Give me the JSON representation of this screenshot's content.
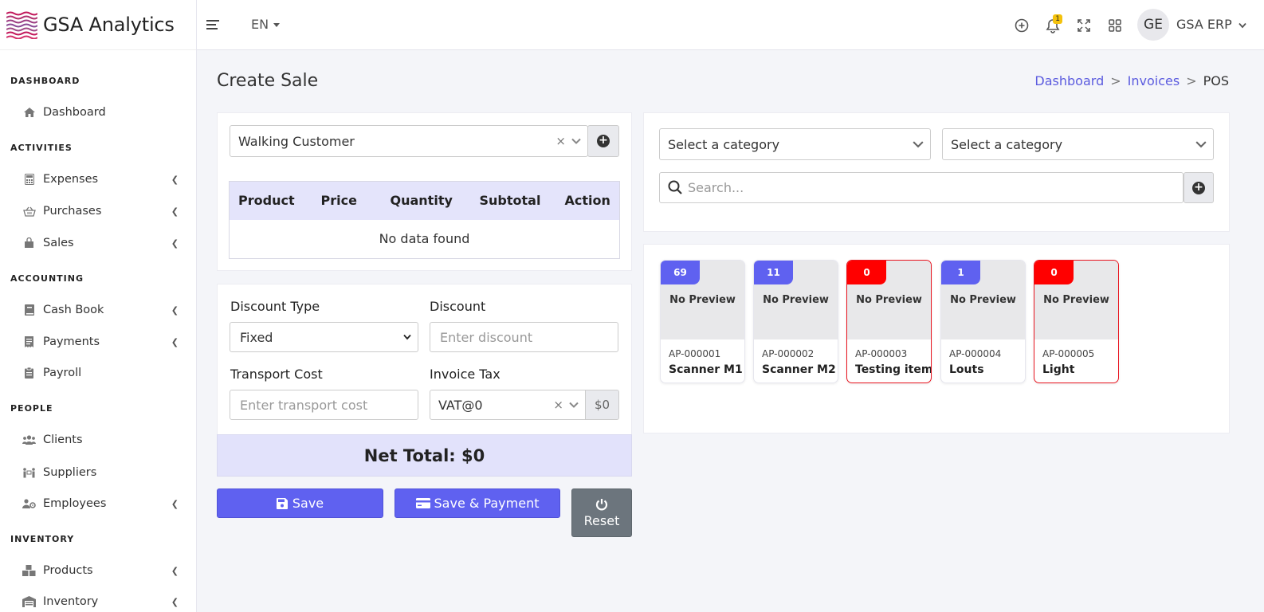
{
  "brand": {
    "name": "GSA Analytics"
  },
  "topbar": {
    "language": "EN",
    "notifications_count": "1",
    "avatar_initials": "GE",
    "user_name": "GSA ERP"
  },
  "sidebar": {
    "sections": [
      {
        "title": "DASHBOARD",
        "items": [
          {
            "label": "Dashboard",
            "icon": "home-icon",
            "has_submenu": false
          }
        ]
      },
      {
        "title": "ACTIVITIES",
        "items": [
          {
            "label": "Expenses",
            "icon": "calculator-icon",
            "has_submenu": true
          },
          {
            "label": "Purchases",
            "icon": "basket-icon",
            "has_submenu": true
          },
          {
            "label": "Sales",
            "icon": "shopping-bag-icon",
            "has_submenu": true
          }
        ]
      },
      {
        "title": "ACCOUNTING",
        "items": [
          {
            "label": "Cash Book",
            "icon": "book-icon",
            "has_submenu": true
          },
          {
            "label": "Payments",
            "icon": "receipt-icon",
            "has_submenu": true
          },
          {
            "label": "Payroll",
            "icon": "clipboard-icon",
            "has_submenu": false
          }
        ]
      },
      {
        "title": "PEOPLE",
        "items": [
          {
            "label": "Clients",
            "icon": "users-icon",
            "has_submenu": false
          },
          {
            "label": "Suppliers",
            "icon": "people-carry-icon",
            "has_submenu": false
          },
          {
            "label": "Employees",
            "icon": "users-cog-icon",
            "has_submenu": true
          }
        ]
      },
      {
        "title": "INVENTORY",
        "items": [
          {
            "label": "Products",
            "icon": "boxes-icon",
            "has_submenu": true
          },
          {
            "label": "Inventory",
            "icon": "warehouse-icon",
            "has_submenu": true
          }
        ]
      }
    ]
  },
  "page": {
    "title": "Create Sale",
    "breadcrumb": {
      "dashboard": "Dashboard",
      "invoices": "Invoices",
      "sep": ">",
      "current": "POS"
    }
  },
  "customer": {
    "selected": "Walking Customer",
    "clear": "×"
  },
  "cart_table": {
    "headers": [
      "Product",
      "Price",
      "Quantity",
      "Subtotal",
      "Action"
    ],
    "empty_message": "No data found"
  },
  "summary": {
    "discount_type_label": "Discount Type",
    "discount_type_value": "Fixed",
    "discount_label": "Discount",
    "discount_placeholder": "Enter discount",
    "transport_label": "Transport Cost",
    "transport_placeholder": "Enter transport cost",
    "tax_label": "Invoice Tax",
    "tax_value": "VAT@0",
    "tax_amount": "$0",
    "net_total_label": "Net Total:",
    "net_total_value": "$0"
  },
  "actions": {
    "save": "Save",
    "save_payment": "Save & Payment",
    "reset": "Reset"
  },
  "filters": {
    "category_1": "Select a category",
    "category_2": "Select a category",
    "search_placeholder": "Search..."
  },
  "products": [
    {
      "stock": "69",
      "preview": "No Preview",
      "code": "AP-000001",
      "name": "Scanner M1",
      "out_of_stock": false
    },
    {
      "stock": "11",
      "preview": "No Preview",
      "code": "AP-000002",
      "name": "Scanner M2",
      "out_of_stock": false
    },
    {
      "stock": "0",
      "preview": "No Preview",
      "code": "AP-000003",
      "name": "Testing item",
      "out_of_stock": true
    },
    {
      "stock": "1",
      "preview": "No Preview",
      "code": "AP-000004",
      "name": "Louts",
      "out_of_stock": false
    },
    {
      "stock": "0",
      "preview": "No Preview",
      "code": "AP-000005",
      "name": "Light",
      "out_of_stock": true
    }
  ],
  "colors": {
    "primary": "#5f61f0",
    "danger": "#ff0000",
    "table_header": "#e4e4fb",
    "reset_button": "#6c757d"
  }
}
